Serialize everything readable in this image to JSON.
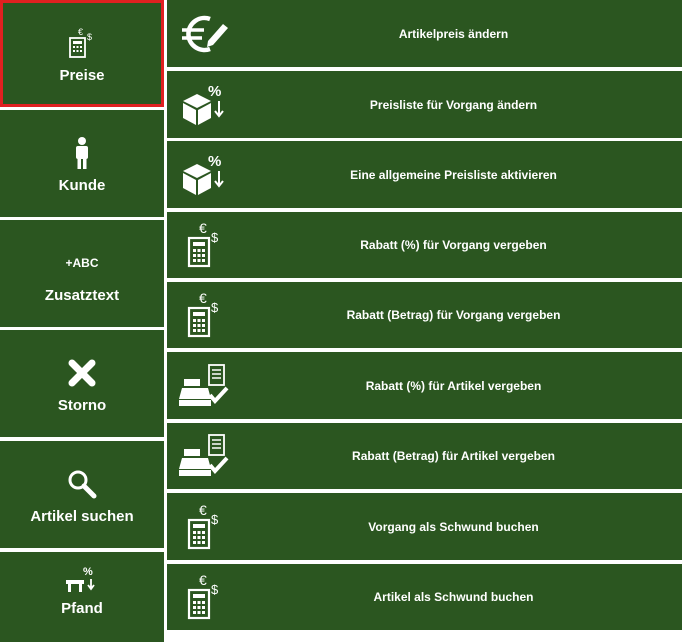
{
  "colors": {
    "tile": "#2b5620",
    "text": "#ffffff",
    "selection": "#e02020",
    "gap": "#ffffff"
  },
  "sidebar": {
    "items": [
      {
        "label": "Preise",
        "icon": "calculator-euro-dollar-icon",
        "selected": true
      },
      {
        "label": "Kunde",
        "icon": "person-icon"
      },
      {
        "label": "Zusatztext",
        "icon": "add-text-icon",
        "icon_text": "+ABC"
      },
      {
        "label": "Storno",
        "icon": "cross-icon"
      },
      {
        "label": "Artikel suchen",
        "icon": "magnifier-icon"
      },
      {
        "label": "Pfand",
        "icon": "table-percent-icon"
      }
    ]
  },
  "actions": [
    {
      "label": "Artikelpreis ändern",
      "icon": "euro-edit-icon"
    },
    {
      "label": "Preisliste für Vorgang ändern",
      "icon": "box-percent-icon"
    },
    {
      "label": "Eine allgemeine Preisliste aktivieren",
      "icon": "box-percent-icon"
    },
    {
      "label": "Rabatt (%) für Vorgang vergeben",
      "icon": "calculator-euro-dollar-icon"
    },
    {
      "label": "Rabatt (Betrag) für Vorgang vergeben",
      "icon": "calculator-euro-dollar-icon"
    },
    {
      "label": "Rabatt (%) für Artikel vergeben",
      "icon": "cash-register-check-icon"
    },
    {
      "label": "Rabatt (Betrag) für Artikel vergeben",
      "icon": "cash-register-check-icon"
    },
    {
      "label": "Vorgang als Schwund buchen",
      "icon": "calculator-euro-dollar-icon"
    },
    {
      "label": "Artikel als Schwund buchen",
      "icon": "calculator-euro-dollar-icon"
    }
  ]
}
